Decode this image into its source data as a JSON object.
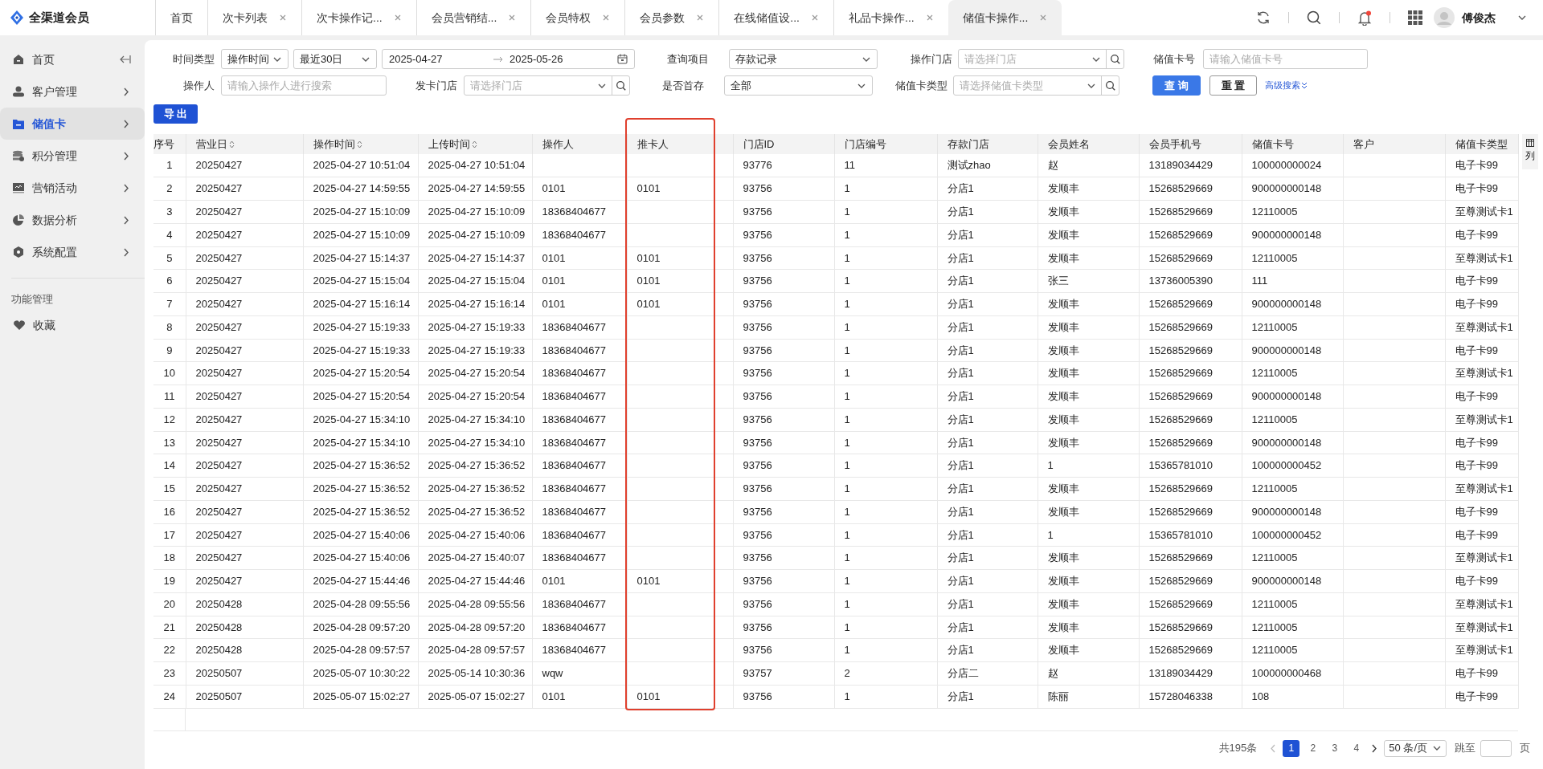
{
  "app": {
    "name": "全渠道会员"
  },
  "tabs": [
    {
      "label": "首页",
      "closable": false,
      "selected": false
    },
    {
      "label": "次卡列表",
      "closable": true,
      "selected": false
    },
    {
      "label": "次卡操作记...",
      "closable": true,
      "selected": false
    },
    {
      "label": "会员营销结...",
      "closable": true,
      "selected": false
    },
    {
      "label": "会员特权",
      "closable": true,
      "selected": false
    },
    {
      "label": "会员参数",
      "closable": true,
      "selected": false
    },
    {
      "label": "在线储值设...",
      "closable": true,
      "selected": false
    },
    {
      "label": "礼品卡操作...",
      "closable": true,
      "selected": false
    },
    {
      "label": "储值卡操作...",
      "closable": true,
      "selected": true
    }
  ],
  "header": {
    "user": "傅俊杰",
    "has_notification": true
  },
  "sidebar": {
    "items": [
      {
        "label": "首页",
        "has_submenu": false,
        "selected": false
      },
      {
        "label": "客户管理",
        "has_submenu": true,
        "selected": false
      },
      {
        "label": "储值卡",
        "has_submenu": true,
        "selected": true
      },
      {
        "label": "积分管理",
        "has_submenu": true,
        "selected": false
      },
      {
        "label": "营销活动",
        "has_submenu": true,
        "selected": false
      },
      {
        "label": "数据分析",
        "has_submenu": true,
        "selected": false
      },
      {
        "label": "系统配置",
        "has_submenu": true,
        "selected": false
      }
    ],
    "section_title": "功能管理",
    "favorites": "收藏"
  },
  "filters": [
    [
      {
        "label": "时间类型",
        "fields": [
          {
            "kind": "select",
            "value": "操作时间"
          },
          {
            "kind": "select",
            "value": "最近30日"
          },
          {
            "kind": "date_range",
            "start": "2025-04-27",
            "end": "2025-05-26"
          }
        ]
      },
      {
        "label": "查询项目",
        "fields": [
          {
            "kind": "select",
            "value": "存款记录"
          }
        ]
      },
      {
        "label": "操作门店",
        "fields": [
          {
            "kind": "select_search",
            "placeholder": "请选择门店"
          }
        ]
      },
      {
        "label": "储值卡号",
        "fields": [
          {
            "kind": "input",
            "placeholder": "请输入储值卡号"
          }
        ]
      }
    ],
    [
      {
        "label": "操作人",
        "fields": [
          {
            "kind": "input",
            "placeholder": "请输入操作人进行搜索"
          }
        ]
      },
      {
        "label": "发卡门店",
        "fields": [
          {
            "kind": "select_search",
            "placeholder": "请选择门店"
          }
        ]
      },
      {
        "label": "是否首存",
        "fields": [
          {
            "kind": "select",
            "value": "全部"
          }
        ]
      },
      {
        "label": "储值卡类型",
        "fields": [
          {
            "kind": "select_search",
            "placeholder": "请选择储值卡类型"
          }
        ]
      }
    ]
  ],
  "filter_buttons": [
    {
      "label": "查 询",
      "kind": "primary"
    },
    {
      "label": "重 置",
      "kind": "default"
    }
  ],
  "advanced_search": "高级搜索",
  "export_button": "导 出",
  "table": {
    "columns": [
      {
        "label": "序号",
        "sortable": false,
        "highlighted": false
      },
      {
        "label": "营业日",
        "sortable": true,
        "highlighted": false
      },
      {
        "label": "操作时间",
        "sortable": true,
        "highlighted": false
      },
      {
        "label": "上传时间",
        "sortable": true,
        "highlighted": false
      },
      {
        "label": "操作人",
        "sortable": false,
        "highlighted": false
      },
      {
        "label": "推卡人",
        "sortable": false,
        "highlighted": true
      },
      {
        "label": "门店ID",
        "sortable": false,
        "highlighted": false
      },
      {
        "label": "门店编号",
        "sortable": false,
        "highlighted": false
      },
      {
        "label": "存款门店",
        "sortable": false,
        "highlighted": false
      },
      {
        "label": "会员姓名",
        "sortable": false,
        "highlighted": false
      },
      {
        "label": "会员手机号",
        "sortable": false,
        "highlighted": false
      },
      {
        "label": "储值卡号",
        "sortable": false,
        "highlighted": false
      },
      {
        "label": "客户",
        "sortable": false,
        "highlighted": false
      },
      {
        "label": "储值卡类型",
        "sortable": false,
        "highlighted": false
      }
    ],
    "rows": [
      [
        "1",
        "20250427",
        "2025-04-27 10:51:04",
        "2025-04-27 10:51:04",
        null,
        null,
        "93776",
        "11",
        "测试zhao",
        "赵",
        "13189034429",
        "100000000024",
        null,
        "电子卡99"
      ],
      [
        "2",
        "20250427",
        "2025-04-27 14:59:55",
        "2025-04-27 14:59:55",
        "0101",
        "0101",
        "93756",
        "1",
        "分店1",
        "发顺丰",
        "15268529669",
        "900000000148",
        null,
        "电子卡99"
      ],
      [
        "3",
        "20250427",
        "2025-04-27 15:10:09",
        "2025-04-27 15:10:09",
        "18368404677",
        null,
        "93756",
        "1",
        "分店1",
        "发顺丰",
        "15268529669",
        "12110005",
        null,
        "至尊测试卡1"
      ],
      [
        "4",
        "20250427",
        "2025-04-27 15:10:09",
        "2025-04-27 15:10:09",
        "18368404677",
        null,
        "93756",
        "1",
        "分店1",
        "发顺丰",
        "15268529669",
        "900000000148",
        null,
        "电子卡99"
      ],
      [
        "5",
        "20250427",
        "2025-04-27 15:14:37",
        "2025-04-27 15:14:37",
        "0101",
        "0101",
        "93756",
        "1",
        "分店1",
        "发顺丰",
        "15268529669",
        "12110005",
        null,
        "至尊测试卡1"
      ],
      [
        "6",
        "20250427",
        "2025-04-27 15:15:04",
        "2025-04-27 15:15:04",
        "0101",
        "0101",
        "93756",
        "1",
        "分店1",
        "张三",
        "13736005390",
        "111",
        null,
        "电子卡99"
      ],
      [
        "7",
        "20250427",
        "2025-04-27 15:16:14",
        "2025-04-27 15:16:14",
        "0101",
        "0101",
        "93756",
        "1",
        "分店1",
        "发顺丰",
        "15268529669",
        "900000000148",
        null,
        "电子卡99"
      ],
      [
        "8",
        "20250427",
        "2025-04-27 15:19:33",
        "2025-04-27 15:19:33",
        "18368404677",
        null,
        "93756",
        "1",
        "分店1",
        "发顺丰",
        "15268529669",
        "12110005",
        null,
        "至尊测试卡1"
      ],
      [
        "9",
        "20250427",
        "2025-04-27 15:19:33",
        "2025-04-27 15:19:33",
        "18368404677",
        null,
        "93756",
        "1",
        "分店1",
        "发顺丰",
        "15268529669",
        "900000000148",
        null,
        "电子卡99"
      ],
      [
        "10",
        "20250427",
        "2025-04-27 15:20:54",
        "2025-04-27 15:20:54",
        "18368404677",
        null,
        "93756",
        "1",
        "分店1",
        "发顺丰",
        "15268529669",
        "12110005",
        null,
        "至尊测试卡1"
      ],
      [
        "11",
        "20250427",
        "2025-04-27 15:20:54",
        "2025-04-27 15:20:54",
        "18368404677",
        null,
        "93756",
        "1",
        "分店1",
        "发顺丰",
        "15268529669",
        "900000000148",
        null,
        "电子卡99"
      ],
      [
        "12",
        "20250427",
        "2025-04-27 15:34:10",
        "2025-04-27 15:34:10",
        "18368404677",
        null,
        "93756",
        "1",
        "分店1",
        "发顺丰",
        "15268529669",
        "12110005",
        null,
        "至尊测试卡1"
      ],
      [
        "13",
        "20250427",
        "2025-04-27 15:34:10",
        "2025-04-27 15:34:10",
        "18368404677",
        null,
        "93756",
        "1",
        "分店1",
        "发顺丰",
        "15268529669",
        "900000000148",
        null,
        "电子卡99"
      ],
      [
        "14",
        "20250427",
        "2025-04-27 15:36:52",
        "2025-04-27 15:36:52",
        "18368404677",
        null,
        "93756",
        "1",
        "分店1",
        "1",
        "15365781010",
        "100000000452",
        null,
        "电子卡99"
      ],
      [
        "15",
        "20250427",
        "2025-04-27 15:36:52",
        "2025-04-27 15:36:52",
        "18368404677",
        null,
        "93756",
        "1",
        "分店1",
        "发顺丰",
        "15268529669",
        "12110005",
        null,
        "至尊测试卡1"
      ],
      [
        "16",
        "20250427",
        "2025-04-27 15:36:52",
        "2025-04-27 15:36:52",
        "18368404677",
        null,
        "93756",
        "1",
        "分店1",
        "发顺丰",
        "15268529669",
        "900000000148",
        null,
        "电子卡99"
      ],
      [
        "17",
        "20250427",
        "2025-04-27 15:40:06",
        "2025-04-27 15:40:06",
        "18368404677",
        null,
        "93756",
        "1",
        "分店1",
        "1",
        "15365781010",
        "100000000452",
        null,
        "电子卡99"
      ],
      [
        "18",
        "20250427",
        "2025-04-27 15:40:06",
        "2025-04-27 15:40:07",
        "18368404677",
        null,
        "93756",
        "1",
        "分店1",
        "发顺丰",
        "15268529669",
        "12110005",
        null,
        "至尊测试卡1"
      ],
      [
        "19",
        "20250427",
        "2025-04-27 15:44:46",
        "2025-04-27 15:44:46",
        "0101",
        "0101",
        "93756",
        "1",
        "分店1",
        "发顺丰",
        "15268529669",
        "900000000148",
        null,
        "电子卡99"
      ],
      [
        "20",
        "20250428",
        "2025-04-28 09:55:56",
        "2025-04-28 09:55:56",
        "18368404677",
        null,
        "93756",
        "1",
        "分店1",
        "发顺丰",
        "15268529669",
        "12110005",
        null,
        "至尊测试卡1"
      ],
      [
        "21",
        "20250428",
        "2025-04-28 09:57:20",
        "2025-04-28 09:57:20",
        "18368404677",
        null,
        "93756",
        "1",
        "分店1",
        "发顺丰",
        "15268529669",
        "12110005",
        null,
        "至尊测试卡1"
      ],
      [
        "22",
        "20250428",
        "2025-04-28 09:57:57",
        "2025-04-28 09:57:57",
        "18368404677",
        null,
        "93756",
        "1",
        "分店1",
        "发顺丰",
        "15268529669",
        "12110005",
        null,
        "至尊测试卡1"
      ],
      [
        "23",
        "20250507",
        "2025-05-07 10:30:22",
        "2025-05-14 10:30:36",
        "wqw",
        null,
        "93757",
        "2",
        "分店二",
        "赵",
        "13189034429",
        "100000000468",
        null,
        "电子卡99"
      ],
      [
        "24",
        "20250507",
        "2025-05-07 15:02:27",
        "2025-05-07 15:02:27",
        "0101",
        "0101",
        "93756",
        "1",
        "分店1",
        "陈丽",
        "15728046338",
        "108",
        null,
        "电子卡99"
      ]
    ]
  },
  "column_settings": "列",
  "pagination": {
    "total": "共195条",
    "pages": [
      {
        "label": "1",
        "selected": true
      },
      {
        "label": "2",
        "selected": false
      },
      {
        "label": "3",
        "selected": false
      },
      {
        "label": "4",
        "selected": false
      }
    ],
    "page_size": "50 条/页",
    "jump_label": "跳至",
    "page_suffix": "页"
  }
}
